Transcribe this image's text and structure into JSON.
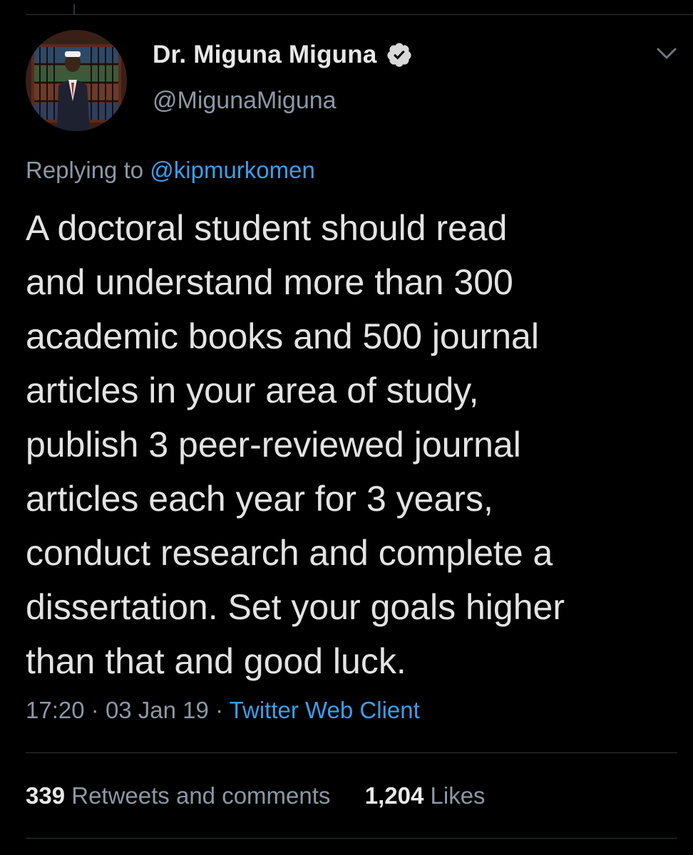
{
  "tweet": {
    "author": {
      "display_name": "Dr. Miguna Miguna",
      "handle": "@MigunaMiguna",
      "verified": true,
      "avatar_icon": "profile-photo-bookshelf"
    },
    "menu_icon": "chevron-down-icon",
    "replying_to": {
      "prefix": "Replying to",
      "mention": "@kipmurkomen"
    },
    "text_lines": [
      "A doctoral student should read",
      "and understand more than 300",
      "academic books and 500 journal",
      "articles in your area of study,",
      "publish 3 peer-reviewed journal",
      "articles each year for 3 years,",
      "conduct research and complete a",
      "dissertation. Set your goals higher",
      "than that and good luck."
    ],
    "time": "17:20",
    "date": "03 Jan 19",
    "separator": "·",
    "client": "Twitter Web Client",
    "stats": {
      "retweets_count": "339",
      "retweets_label": "Retweets and comments",
      "likes_count": "1,204",
      "likes_label": "Likes"
    }
  },
  "colors": {
    "background": "#000000",
    "text": "#e3e3e3",
    "secondary": "#8b98a5",
    "link": "#3b9eea",
    "divider": "#2f3336"
  }
}
